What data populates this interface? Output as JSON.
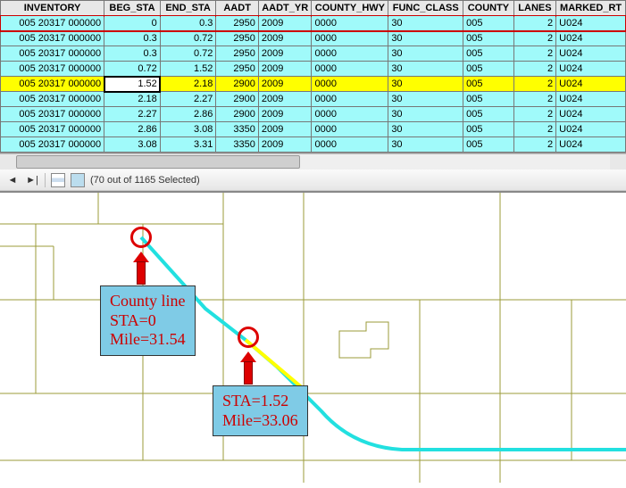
{
  "columns": [
    "INVENTORY",
    "BEG_STA",
    "END_STA",
    "AADT",
    "AADT_YR",
    "COUNTY_HWY",
    "FUNC_CLASS",
    "COUNTY",
    "LANES",
    "MARKED_RT"
  ],
  "rows": [
    {
      "inv": "005  20317 000000",
      "beg": "0",
      "end": "0.3",
      "aadt": "2950",
      "yr": "2009",
      "chwy": "0000",
      "fc": "30",
      "cty": "005",
      "ln": "2",
      "mrt": "U024",
      "sel": true
    },
    {
      "inv": "005  20317 000000",
      "beg": "0.3",
      "end": "0.72",
      "aadt": "2950",
      "yr": "2009",
      "chwy": "0000",
      "fc": "30",
      "cty": "005",
      "ln": "2",
      "mrt": "U024"
    },
    {
      "inv": "005  20317 000000",
      "beg": "0.3",
      "end": "0.72",
      "aadt": "2950",
      "yr": "2009",
      "chwy": "0000",
      "fc": "30",
      "cty": "005",
      "ln": "2",
      "mrt": "U024"
    },
    {
      "inv": "005  20317 000000",
      "beg": "0.72",
      "end": "1.52",
      "aadt": "2950",
      "yr": "2009",
      "chwy": "0000",
      "fc": "30",
      "cty": "005",
      "ln": "2",
      "mrt": "U024"
    },
    {
      "inv": "005  20317 000000",
      "beg": "1.52",
      "end": "2.18",
      "aadt": "2900",
      "yr": "2009",
      "chwy": "0000",
      "fc": "30",
      "cty": "005",
      "ln": "2",
      "mrt": "U024",
      "yellow": true
    },
    {
      "inv": "005  20317 000000",
      "beg": "2.18",
      "end": "2.27",
      "aadt": "2900",
      "yr": "2009",
      "chwy": "0000",
      "fc": "30",
      "cty": "005",
      "ln": "2",
      "mrt": "U024"
    },
    {
      "inv": "005  20317 000000",
      "beg": "2.27",
      "end": "2.86",
      "aadt": "2900",
      "yr": "2009",
      "chwy": "0000",
      "fc": "30",
      "cty": "005",
      "ln": "2",
      "mrt": "U024"
    },
    {
      "inv": "005  20317 000000",
      "beg": "2.86",
      "end": "3.08",
      "aadt": "3350",
      "yr": "2009",
      "chwy": "0000",
      "fc": "30",
      "cty": "005",
      "ln": "2",
      "mrt": "U024"
    },
    {
      "inv": "005  20317 000000",
      "beg": "3.08",
      "end": "3.31",
      "aadt": "3350",
      "yr": "2009",
      "chwy": "0000",
      "fc": "30",
      "cty": "005",
      "ln": "2",
      "mrt": "U024"
    }
  ],
  "toolbar": {
    "prev": "◄",
    "next": "►|",
    "status": "(70 out of 1165 Selected)"
  },
  "callouts": {
    "a": {
      "l1": "County line",
      "l2": "STA=0",
      "l3": "Mile=31.54"
    },
    "b": {
      "l1": "STA=1.52",
      "l2": "Mile=33.06"
    }
  }
}
